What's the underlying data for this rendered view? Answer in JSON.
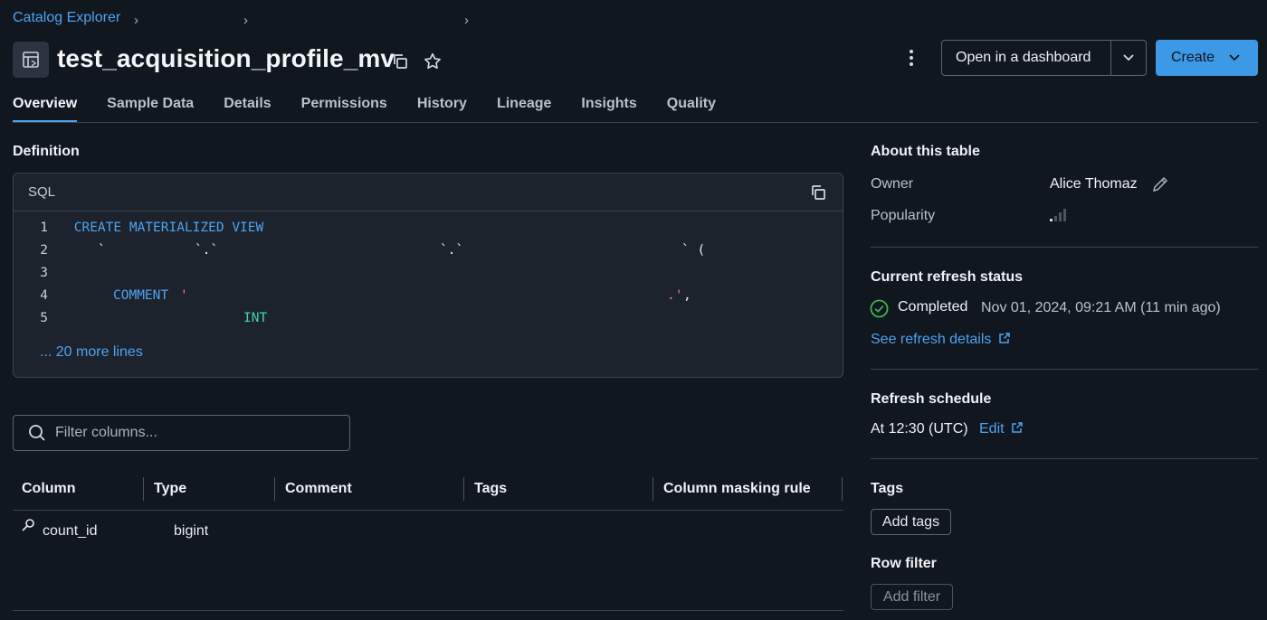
{
  "breadcrumb": {
    "root": "Catalog Explorer"
  },
  "header": {
    "title": "test_acquisition_profile_mv",
    "open_dashboard_label": "Open in a dashboard",
    "create_label": "Create"
  },
  "tabs": [
    "Overview",
    "Sample Data",
    "Details",
    "Permissions",
    "History",
    "Lineage",
    "Insights",
    "Quality"
  ],
  "definition": {
    "heading": "Definition",
    "language": "SQL",
    "lines": [
      {
        "num": "1",
        "kw": "CREATE MATERIALIZED VIEW"
      },
      {
        "num": "2",
        "p1": "`",
        "p2": "`.`",
        "p3": "`.`",
        "p4": "` ("
      },
      {
        "num": "3"
      },
      {
        "num": "4",
        "kw": "COMMENT",
        "str": "'",
        "tail_str": ".'",
        "tail_pun": ","
      },
      {
        "num": "5",
        "type": "INT"
      }
    ],
    "more_lines": "... 20 more lines"
  },
  "filter": {
    "placeholder": "Filter columns..."
  },
  "columns_table": {
    "headers": [
      "Column",
      "Type",
      "Comment",
      "Tags",
      "Column masking rule"
    ],
    "rows": [
      {
        "column": "count_id",
        "type": "bigint"
      }
    ]
  },
  "about": {
    "heading": "About this table",
    "owner_label": "Owner",
    "owner_value": "Alice Thomaz",
    "popularity_label": "Popularity"
  },
  "refresh_status": {
    "heading": "Current refresh status",
    "status": "Completed",
    "timestamp": "Nov 01, 2024, 09:21 AM (11 min ago)",
    "details_link": "See refresh details"
  },
  "refresh_schedule": {
    "heading": "Refresh schedule",
    "value": "At 12:30 (UTC)",
    "edit_link": "Edit"
  },
  "tags": {
    "heading": "Tags",
    "add_label": "Add tags"
  },
  "row_filter": {
    "heading": "Row filter",
    "add_label": "Add filter"
  },
  "colors": {
    "accent": "#4ea3f1",
    "success": "#3fb950",
    "background": "#11171f"
  }
}
